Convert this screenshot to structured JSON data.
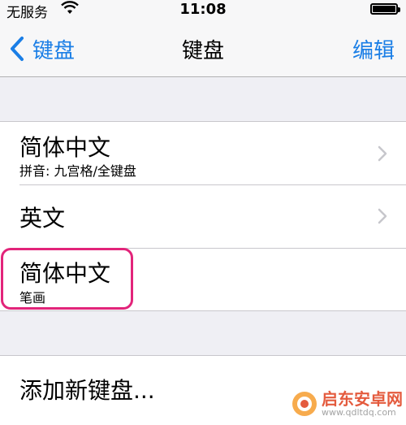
{
  "status_bar": {
    "carrier": "无服务",
    "time": "11:08",
    "wifi_icon": "wifi-icon",
    "battery_icon": "battery-icon"
  },
  "nav": {
    "back_label": "键盘",
    "title": "键盘",
    "edit_label": "编辑"
  },
  "keyboards": [
    {
      "title": "简体中文",
      "subtitle": "拼音: 九宫格/全键盘",
      "has_chevron": true
    },
    {
      "title": "英文",
      "subtitle": "",
      "has_chevron": true
    },
    {
      "title": "简体中文",
      "subtitle": "笔画",
      "has_chevron": false
    }
  ],
  "add_keyboard": {
    "label": "添加新键盘..."
  },
  "watermark": {
    "brand": "启东安卓网",
    "url": "www.qdltdq.com"
  },
  "colors": {
    "accent": "#1a7ee6",
    "highlight": "#e2247a",
    "background": "#efeff4"
  }
}
